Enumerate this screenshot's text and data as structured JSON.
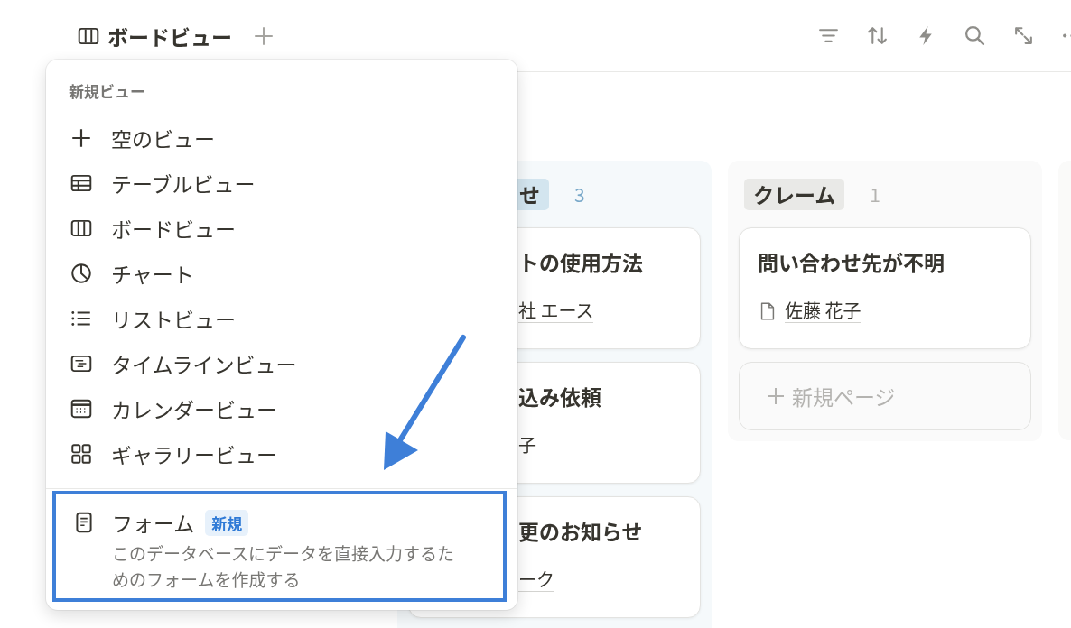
{
  "view_tabs": [
    {
      "label": "ボードビュー",
      "selected": true
    }
  ],
  "board": {
    "columns": [
      {
        "title": "せ",
        "count": "3",
        "color": "#d3e5ef",
        "clipped": true,
        "cards": [
          {
            "title": "トの使用方法",
            "property": "社 エース"
          },
          {
            "title": "込み依頼",
            "property": "子"
          },
          {
            "title": "更のお知らせ",
            "property": "ーク"
          }
        ]
      },
      {
        "title": "クレーム",
        "count": "1",
        "color": "#e9e9e7",
        "clipped": false,
        "cards": [
          {
            "title": "問い合わせ先が不明",
            "property": "佐藤 花子"
          }
        ],
        "new_page_label": "新規ページ"
      }
    ]
  },
  "menu": {
    "heading": "新規ビュー",
    "items": [
      {
        "label": "空のビュー",
        "kind": "empty"
      },
      {
        "label": "テーブルビュー",
        "kind": "table"
      },
      {
        "label": "ボードビュー",
        "kind": "board"
      },
      {
        "label": "チャート",
        "kind": "chart"
      },
      {
        "label": "リストビュー",
        "kind": "list"
      },
      {
        "label": "タイムラインビュー",
        "kind": "timeline"
      },
      {
        "label": "カレンダービュー",
        "kind": "calendar"
      },
      {
        "label": "ギャラリービュー",
        "kind": "gallery"
      }
    ],
    "featured": {
      "label": "フォーム",
      "badge": "新規",
      "description": "このデータベースにデータを直接入力するためのフォームを作成する",
      "highlighted": true
    }
  }
}
